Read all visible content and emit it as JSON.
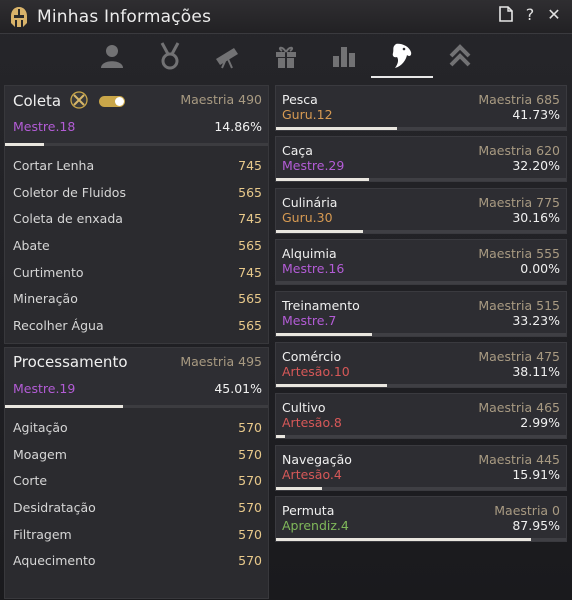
{
  "window": {
    "title": "Minhas Informações",
    "actions": [
      "document-icon",
      "help-icon",
      "close-icon"
    ]
  },
  "tabs": [
    {
      "icon": "character-icon",
      "active": false
    },
    {
      "icon": "medal-icon",
      "active": false
    },
    {
      "icon": "telescope-icon",
      "active": false
    },
    {
      "icon": "gift-icon",
      "active": false
    },
    {
      "icon": "bar-chart-icon",
      "active": false
    },
    {
      "icon": "lifeskill-horse-icon",
      "active": true
    },
    {
      "icon": "rank-chevron-icon",
      "active": false
    }
  ],
  "coleta": {
    "title": "Coleta",
    "mastery": "Maestria 490",
    "rank": "Mestre.18",
    "rank_color": "#b35cd6",
    "pct": "14.86%",
    "progress": 0.1486,
    "toggle_on": true,
    "items": [
      {
        "label": "Cortar Lenha",
        "value": "745"
      },
      {
        "label": "Coletor de Fluidos",
        "value": "565"
      },
      {
        "label": "Coleta de enxada",
        "value": "745"
      },
      {
        "label": "Abate",
        "value": "565"
      },
      {
        "label": "Curtimento",
        "value": "745"
      },
      {
        "label": "Mineração",
        "value": "565"
      },
      {
        "label": "Recolher Água",
        "value": "565"
      }
    ]
  },
  "processamento": {
    "title": "Processamento",
    "mastery": "Maestria 495",
    "rank": "Mestre.19",
    "rank_color": "#b35cd6",
    "pct": "45.01%",
    "progress": 0.4501,
    "items": [
      {
        "label": "Agitação",
        "value": "570"
      },
      {
        "label": "Moagem",
        "value": "570"
      },
      {
        "label": "Corte",
        "value": "570"
      },
      {
        "label": "Desidratação",
        "value": "570"
      },
      {
        "label": "Filtragem",
        "value": "570"
      },
      {
        "label": "Aquecimento",
        "value": "570"
      }
    ]
  },
  "lifeskills": [
    {
      "name": "Pesca",
      "mastery": "Maestria 685",
      "rank": "Guru.12",
      "rank_color": "#d79a52",
      "pct": "41.73%",
      "progress": 0.4173
    },
    {
      "name": "Caça",
      "mastery": "Maestria 620",
      "rank": "Mestre.29",
      "rank_color": "#b35cd6",
      "pct": "32.20%",
      "progress": 0.322
    },
    {
      "name": "Culinária",
      "mastery": "Maestria 775",
      "rank": "Guru.30",
      "rank_color": "#d79a52",
      "pct": "30.16%",
      "progress": 0.3016
    },
    {
      "name": "Alquimia",
      "mastery": "Maestria 555",
      "rank": "Mestre.16",
      "rank_color": "#b35cd6",
      "pct": "0.00%",
      "progress": 0.0
    },
    {
      "name": "Treinamento",
      "mastery": "Maestria 515",
      "rank": "Mestre.7",
      "rank_color": "#b35cd6",
      "pct": "33.23%",
      "progress": 0.3323
    },
    {
      "name": "Comércio",
      "mastery": "Maestria 475",
      "rank": "Artesão.10",
      "rank_color": "#d65858",
      "pct": "38.11%",
      "progress": 0.3811
    },
    {
      "name": "Cultivo",
      "mastery": "Maestria 465",
      "rank": "Artesão.8",
      "rank_color": "#d65858",
      "pct": "2.99%",
      "progress": 0.0299
    },
    {
      "name": "Navegação",
      "mastery": "Maestria 445",
      "rank": "Artesão.4",
      "rank_color": "#d65858",
      "pct": "15.91%",
      "progress": 0.1591
    },
    {
      "name": "Permuta",
      "mastery": "Maestria 0",
      "rank": "Aprendiz.4",
      "rank_color": "#7fb85a",
      "pct": "87.95%",
      "progress": 0.8795
    }
  ]
}
